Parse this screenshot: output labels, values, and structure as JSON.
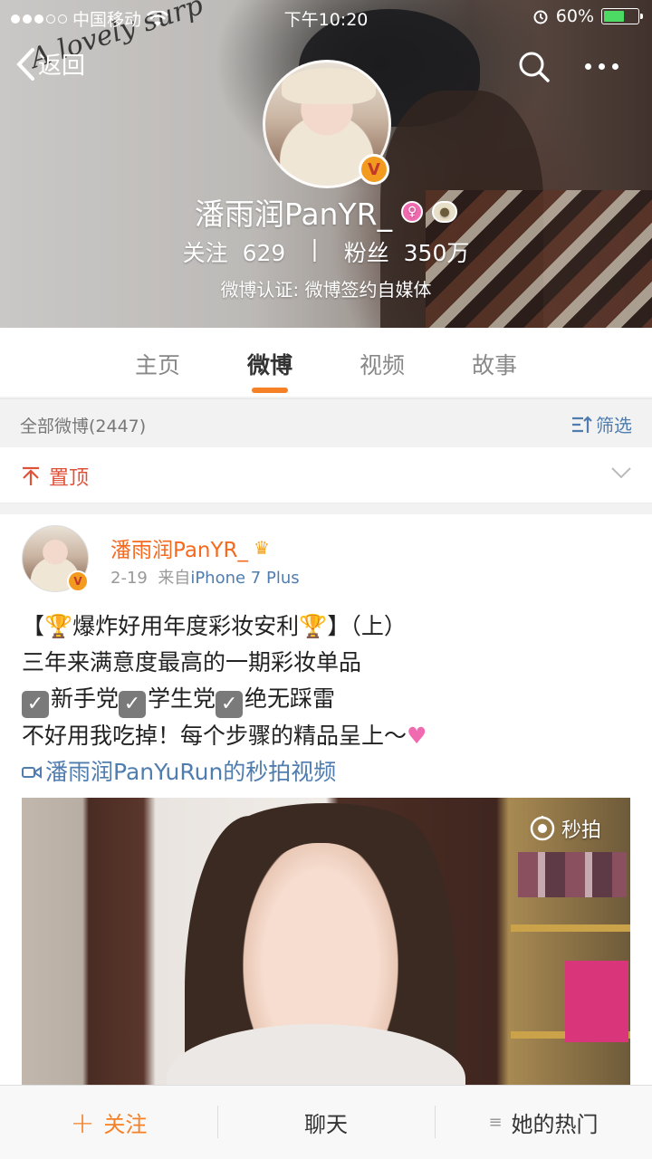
{
  "status_bar": {
    "carrier": "中国移动",
    "time": "下午10:20",
    "battery_percent": "60%",
    "battery_level": 0.6
  },
  "nav": {
    "back_label": "返回"
  },
  "header": {
    "script_text": "A lovely surp",
    "username": "潘雨润PanYR_",
    "following_label": "关注",
    "following_count": "629",
    "separator": "|",
    "followers_label": "粉丝",
    "followers_count": "350万",
    "verification": "微博认证: 微博签约自媒体"
  },
  "tabs": [
    {
      "label": "主页",
      "active": false
    },
    {
      "label": "微博",
      "active": true
    },
    {
      "label": "视频",
      "active": false
    },
    {
      "label": "故事",
      "active": false
    }
  ],
  "filter": {
    "count_label": "全部微博(2447)",
    "filter_label": "筛选"
  },
  "pinned": {
    "label": "置顶"
  },
  "post": {
    "author": "潘雨润PanYR_",
    "date": "2-19",
    "source_prefix": "来自",
    "source": "iPhone 7 Plus",
    "line1_a": "【",
    "line1_b": "爆炸好用年度彩妆安利",
    "line1_c": "】（上）",
    "line2": "三年来满意度最高的一期彩妆单品",
    "line3_a": "新手党",
    "line3_b": "学生党",
    "line3_c": "绝无踩雷",
    "line4": "不好用我吃掉！每个步骤的精品呈上～",
    "video_link": "潘雨润PanYuRun的秒拍视频",
    "video_watermark": "秒拍"
  },
  "bottom_bar": {
    "follow_label": "关注",
    "chat_label": "聊天",
    "hot_label": "她的热门"
  },
  "colors": {
    "accent_orange": "#f58025",
    "link_blue": "#507daf",
    "pin_red": "#e0513a"
  }
}
